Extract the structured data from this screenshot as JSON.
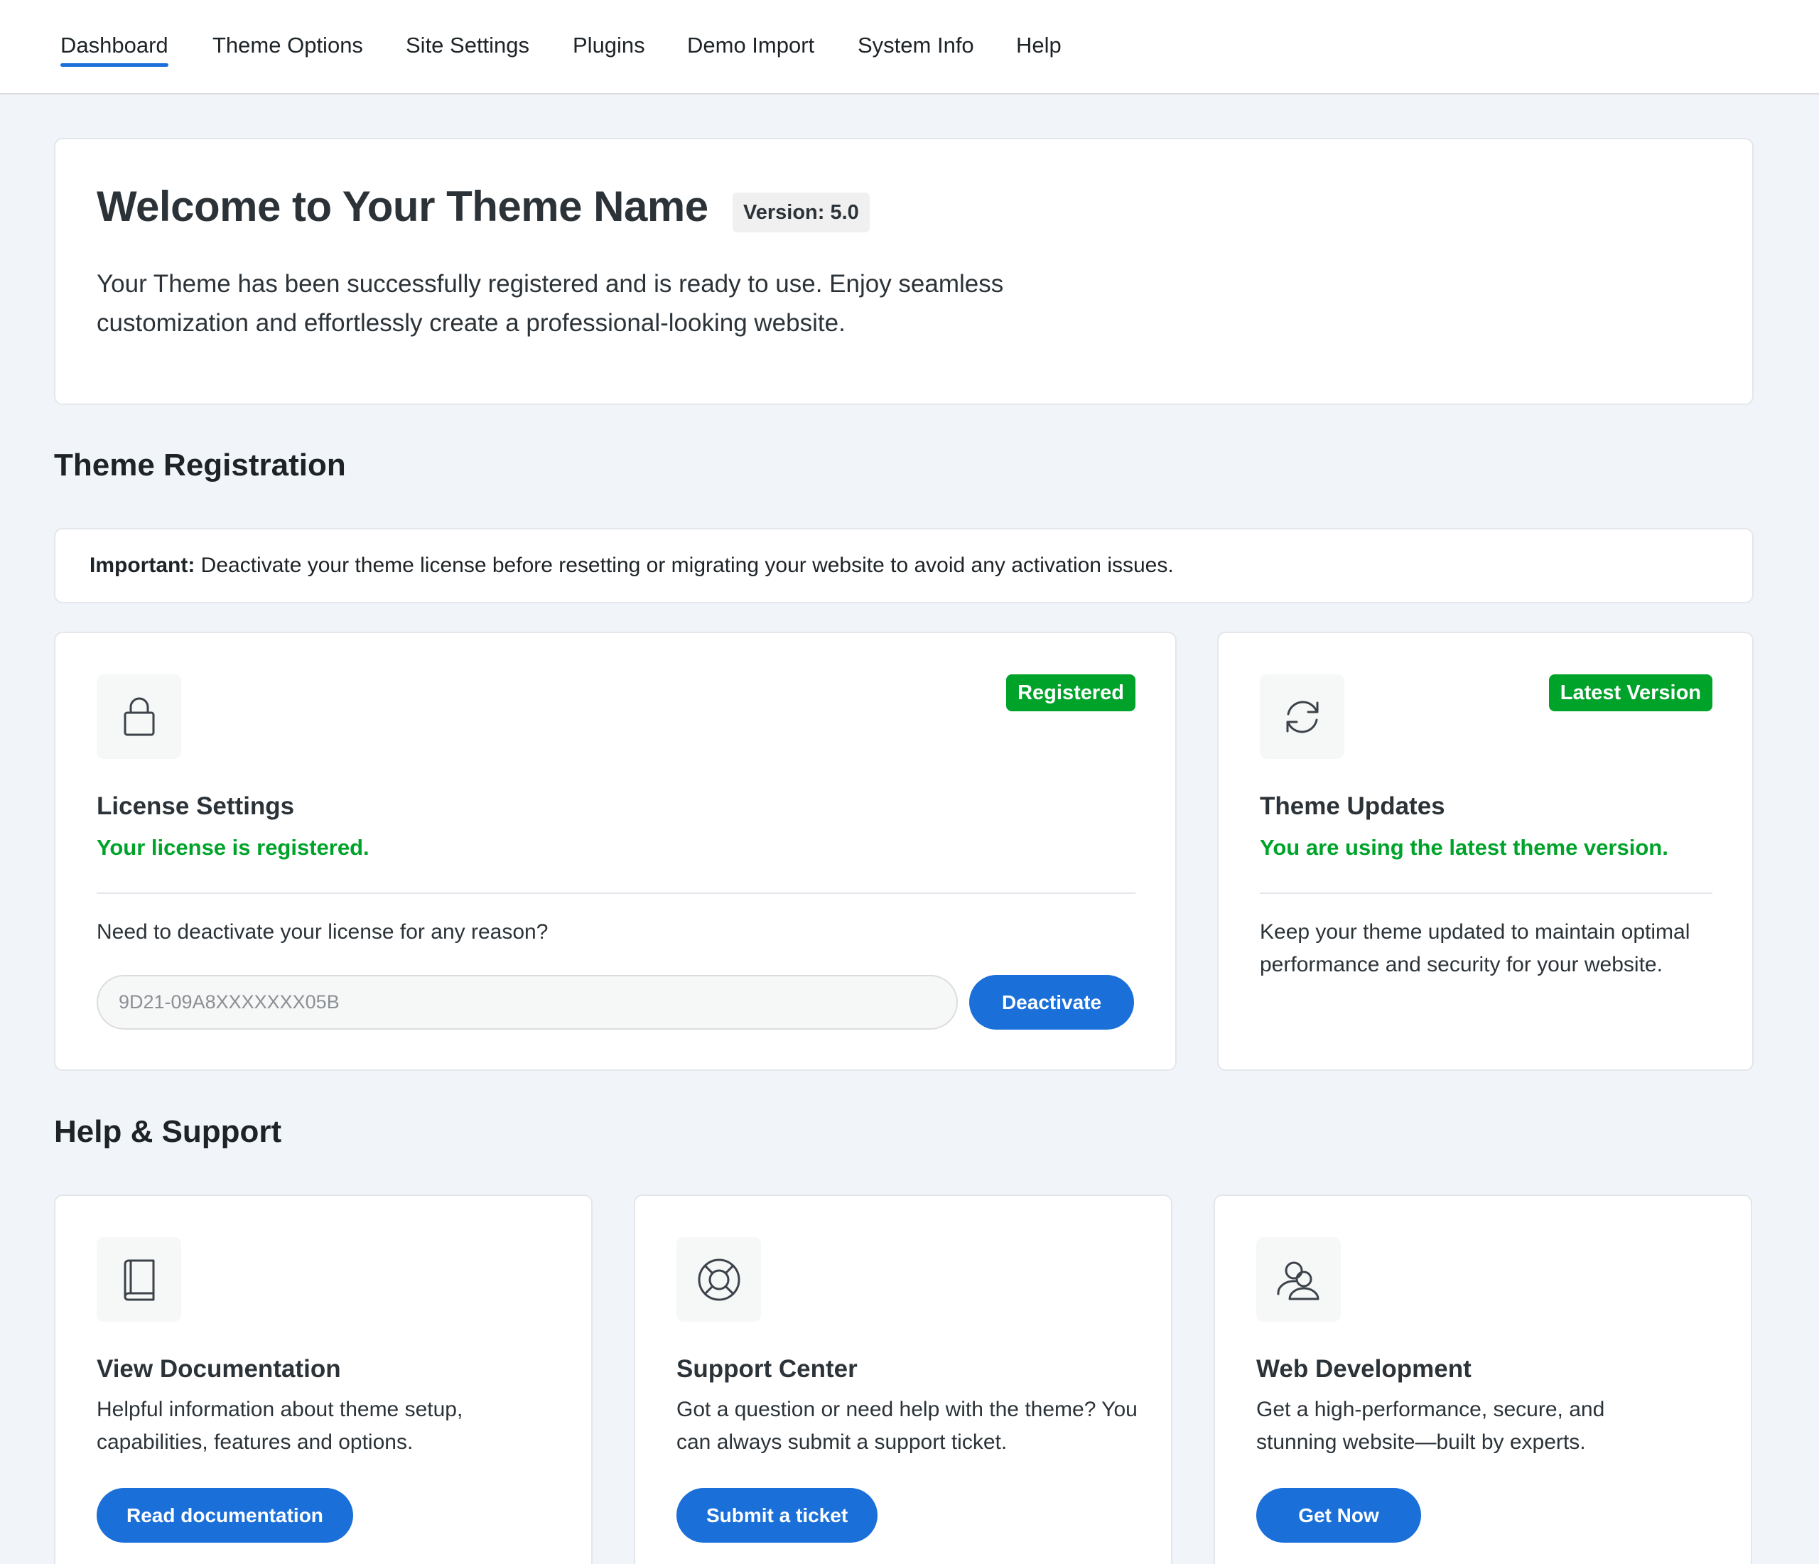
{
  "nav": {
    "tabs": [
      {
        "label": "Dashboard",
        "active": true
      },
      {
        "label": "Theme Options"
      },
      {
        "label": "Site Settings"
      },
      {
        "label": "Plugins"
      },
      {
        "label": "Demo Import"
      },
      {
        "label": "System Info"
      },
      {
        "label": "Help"
      }
    ]
  },
  "welcome": {
    "title": "Welcome to Your Theme Name",
    "version": "Version: 5.0",
    "description": "Your Theme has been successfully registered and is ready to use. Enjoy seamless customization and effortlessly create a professional-looking website."
  },
  "registration": {
    "section_title": "Theme Registration",
    "notice_label": "Important:",
    "notice_text": " Deactivate your theme license before resetting or migrating your website to avoid any activation issues.",
    "license": {
      "icon": "lock-icon",
      "badge": "Registered",
      "heading": "License Settings",
      "status": "Your license is registered.",
      "prompt": "Need to deactivate your license for any reason?",
      "key_placeholder": "9D21-09A8XXXXXXX05B",
      "deactivate_label": "Deactivate"
    },
    "updates": {
      "icon": "refresh-icon",
      "badge": "Latest Version",
      "heading": "Theme Updates",
      "status": "You are using the latest theme version.",
      "description": "Keep your theme updated to maintain optimal performance and security for your website."
    }
  },
  "support": {
    "section_title": "Help & Support",
    "cards": [
      {
        "icon": "book-icon",
        "heading": "View Documentation",
        "description": "Helpful information about theme setup, capabilities, features and options.",
        "button": "Read documentation"
      },
      {
        "icon": "lifebuoy-icon",
        "heading": "Support Center",
        "description": "Got a question or need help with the theme? You can always submit a support ticket.",
        "button": "Submit a ticket"
      },
      {
        "icon": "users-icon",
        "heading": "Web Development",
        "description": "Get a high-performance, secure, and stunning website—built by experts.",
        "button": "Get Now"
      }
    ]
  },
  "colors": {
    "accent": "#1a6fd9",
    "success": "#00a32a",
    "background": "#f1f4f8"
  }
}
